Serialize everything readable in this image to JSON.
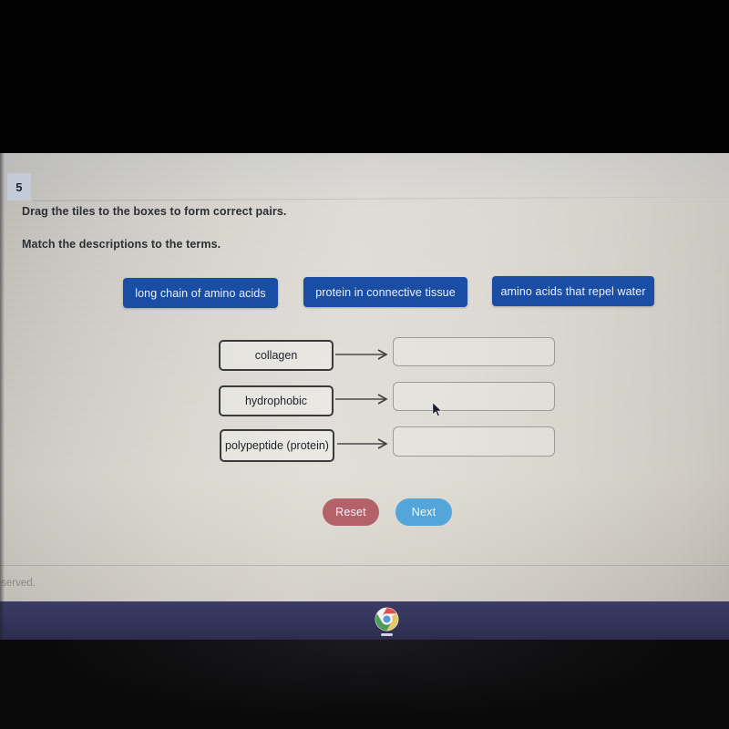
{
  "question": {
    "number": "5",
    "instruction_1": "Drag the tiles to the boxes to form correct pairs.",
    "instruction_2": "Match the descriptions to the terms."
  },
  "tiles": [
    {
      "label": "long chain of amino acids"
    },
    {
      "label": "protein in connective tissue"
    },
    {
      "label": "amino acids that repel water"
    }
  ],
  "pairs": [
    {
      "term": "collagen",
      "answer": ""
    },
    {
      "term": "hydrophobic",
      "answer": ""
    },
    {
      "term": "polypeptide (protein)",
      "answer": ""
    }
  ],
  "buttons": {
    "reset": "Reset",
    "next": "Next"
  },
  "footer": {
    "copyright": "ghts reserved."
  },
  "taskbar": {
    "app": "chrome-icon"
  },
  "colors": {
    "tile_blue": "#1a4da4",
    "reset_red": "#b5616a",
    "next_blue": "#53a6da",
    "badge_bg": "#c4cbd8",
    "taskbar": "#33345a"
  }
}
